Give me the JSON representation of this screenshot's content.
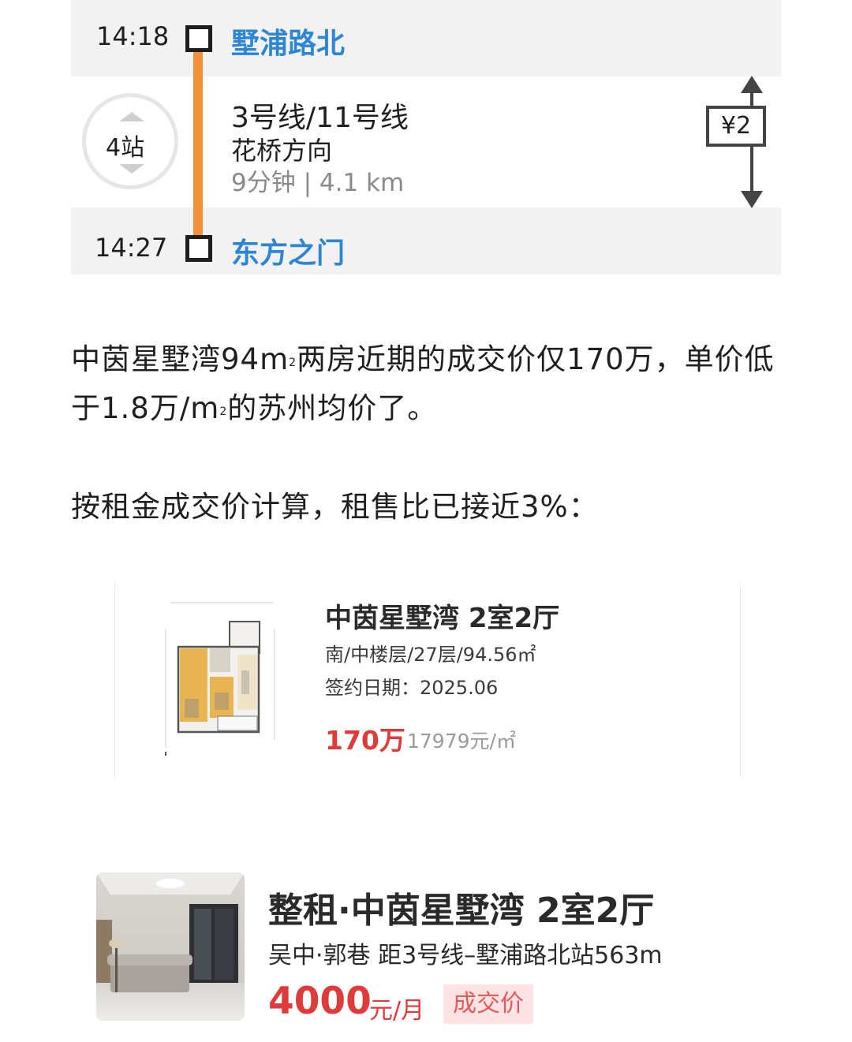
{
  "route": {
    "departure_time": "14:18",
    "departure_station": "墅浦路北",
    "arrival_time": "14:27",
    "arrival_station": "东方之门",
    "stops": "4站",
    "line": "3号线/11号线",
    "direction": "花桥方向",
    "duration": "9分钟 | 4.1 km",
    "fare": "¥2",
    "line_color": "#f0913a",
    "station_color": "#2e86d3"
  },
  "article": {
    "para1_a": "中茵星墅湾94m",
    "para1_sup": "2",
    "para1_b": "两房近期的成交价仅170万，单价低于1.8万/m",
    "para1_sup2": "2",
    "para1_c": "的苏州均价了。",
    "para2": "按租金成交价计算，租售比已接近3%："
  },
  "sold_listing": {
    "title": "中茵星墅湾 2室2厅",
    "meta": "南/中楼层/27层/94.56㎡",
    "date": "签约日期：2025.06",
    "price": "170万",
    "unit_price": "17979元/㎡",
    "image": "floorplan-image",
    "price_color": "#e03b3b"
  },
  "rent_listing": {
    "title": "整租·中茵星墅湾 2室2厅",
    "location": "吴中·郭巷 距3号线–墅浦路北站563m",
    "price": "4000",
    "price_unit": "元/月",
    "badge": "成交价",
    "image": "living-room-photo",
    "price_color": "#e03b3b"
  }
}
